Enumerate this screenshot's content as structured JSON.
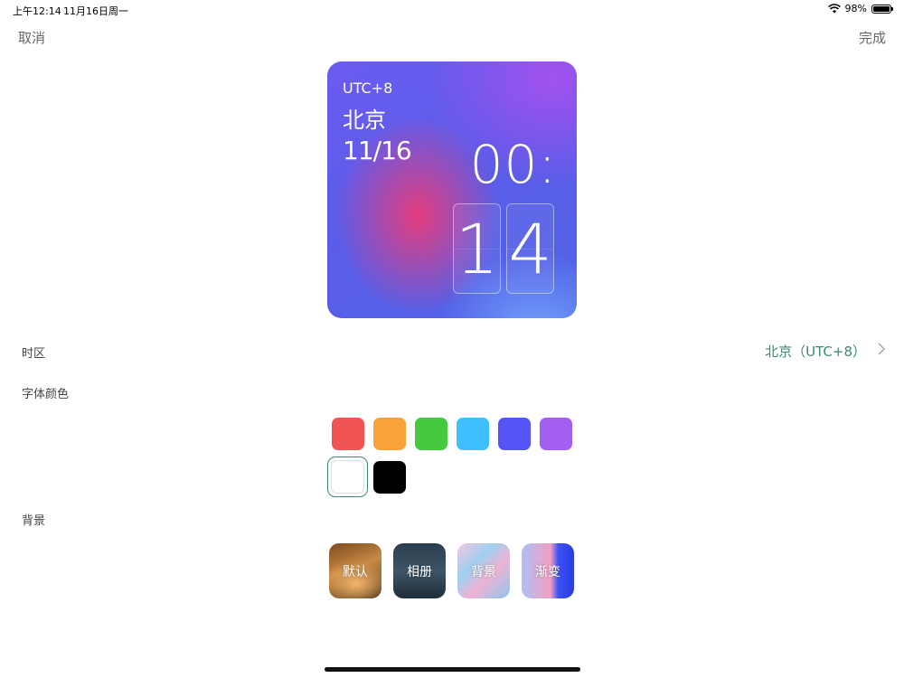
{
  "status_bar": {
    "time": "上午12:14",
    "date": "11月16日周一",
    "battery": "98%",
    "battery_level": 0.98
  },
  "nav": {
    "cancel": "取消",
    "done": "完成"
  },
  "widget": {
    "utc": "UTC+8",
    "city": "北京",
    "date": "11/16",
    "hours": "00:",
    "minute_digit_1": "1",
    "minute_digit_2": "4"
  },
  "settings": {
    "timezone_label": "时区",
    "timezone_value": "北京（UTC+8）",
    "font_color_label": "字体颜色",
    "background_label": "背景"
  },
  "colors": {
    "accent": "#3a8a70",
    "swatches": [
      "#f05454",
      "#f8a23a",
      "#45c93e",
      "#3ec0ff",
      "#5454f7",
      "#a55ff0",
      "#ffffff",
      "#000000"
    ],
    "selected": "#ffffff"
  },
  "backgrounds": {
    "default": "默认",
    "album": "相册",
    "background": "背景",
    "gradient": "渐变"
  }
}
